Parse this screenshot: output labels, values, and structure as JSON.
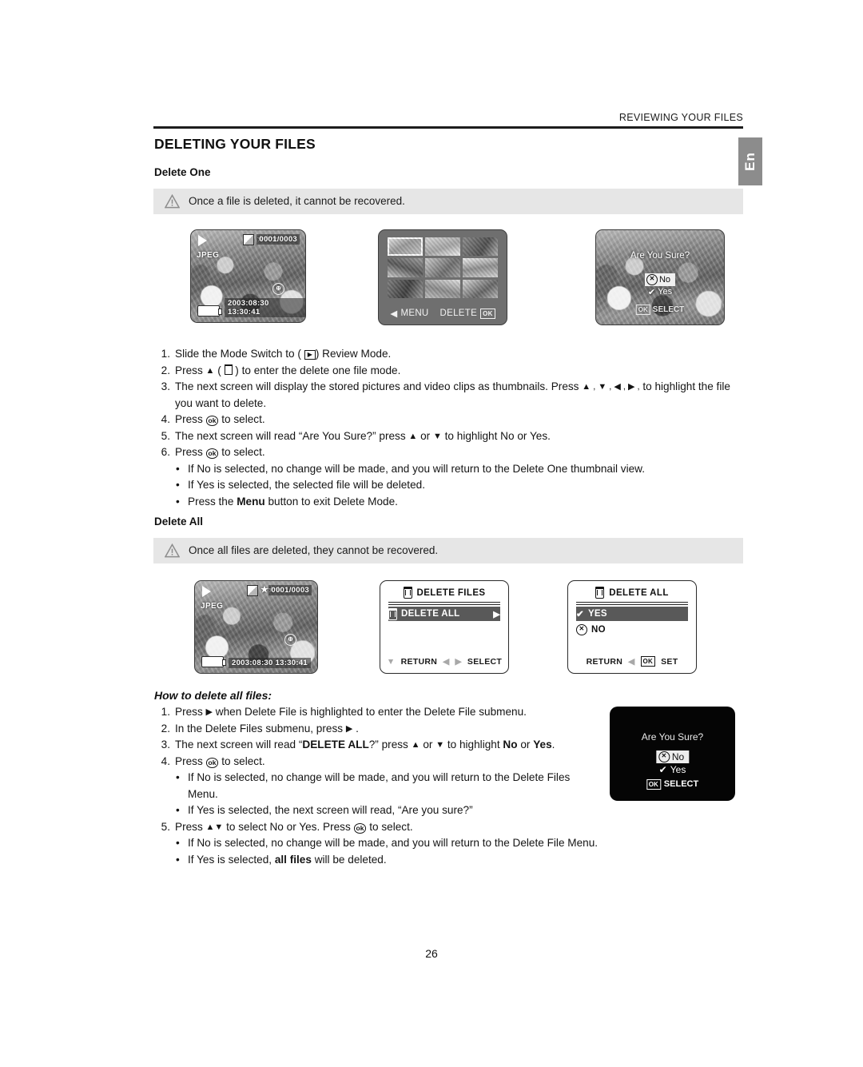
{
  "page": {
    "running_head": "REVIEWING YOUR FILES",
    "language_tab": "En",
    "page_number": "26",
    "title": "DELETING YOUR FILES"
  },
  "delete_one": {
    "heading": "Delete One",
    "warning": "Once a file is deleted, it cannot be recovered.",
    "warning_icon": "warning-triangle-icon",
    "steps": [
      {
        "num": "1.",
        "text_before": "Slide the Mode Switch to (",
        "glyph": "play-icon",
        "text_after": ") Review Mode."
      },
      {
        "num": "2.",
        "text_before": "Press",
        "glyph1": "up-arrow-icon",
        "mid": "(",
        "glyph2": "trash-icon",
        "mid2": ")",
        "text_after": "to enter the delete one file mode."
      },
      {
        "num": "3.",
        "text": "The next screen will display the stored pictures and video clips as thumbnails. Press",
        "arrows": "▲ , ▼ , ◀ , ▶ ,",
        "text2": "to highlight the file you want to delete."
      },
      {
        "num": "4.",
        "text_before": "Press",
        "glyph": "ok-button-icon",
        "text_after": "to select."
      },
      {
        "num": "5.",
        "text_before": "The next screen will read “Are You Sure?” press",
        "glyph1": "up-arrow-icon",
        "mid": "or",
        "glyph2": "down-arrow-icon",
        "text_after": "to highlight No or Yes."
      },
      {
        "num": "6.",
        "text_before": "Press",
        "glyph": "ok-button-icon",
        "text_after": "to select."
      }
    ],
    "bullets": [
      "If No is selected, no change will be made, and you will return to the Delete One thumbnail view.",
      "If Yes is selected, the selected file will be deleted.",
      "Press the Menu button to exit Delete Mode."
    ],
    "bullet3_bold": "Menu"
  },
  "delete_all": {
    "heading": "Delete All",
    "warning": "Once all files are deleted, they cannot be recovered.",
    "howto_heading": "How to delete all files:",
    "steps": [
      {
        "num": "1.",
        "text_before": "Press",
        "glyph": "right-arrow-icon",
        "text_after": "when Delete File is highlighted to enter the Delete File submenu."
      },
      {
        "num": "2.",
        "text_before": "In the Delete Files submenu, press",
        "glyph": "right-arrow-icon",
        "text_after": "."
      },
      {
        "num": "3.",
        "text_before": "The next screen will read “",
        "bold1": "DELETE ALL",
        "mid_a": "?” press",
        "glyph1": "up-arrow-icon",
        "mid_b": "or",
        "glyph2": "down-arrow-icon",
        "mid_c": "to highlight",
        "bold2": "No",
        "mid_d": "or",
        "bold3": "Yes",
        "mid_e": "."
      },
      {
        "num": "4.",
        "text_before": "Press",
        "glyph": "ok-button-icon",
        "text_after": "to select."
      },
      {
        "num": "5.",
        "text_before": "Press",
        "glyph1": "up-arrow-icon",
        "glyph2": "down-arrow-icon",
        "mid": "to select No or Yes. Press",
        "glyph3": "ok-button-icon",
        "text_after": "to select."
      }
    ],
    "bullets_4": [
      "If No is selected, no change will be made, and you will return to the Delete Files Menu.",
      "If Yes is selected, the next screen will read, “Are you sure?”"
    ],
    "bullets_5": [
      "If No is selected, no change will be made, and you will return to the Delete File Menu.",
      "If Yes is selected, all files will be deleted."
    ],
    "bullet5_bold": "all files"
  },
  "screens": {
    "photo_lcd": {
      "play_icon": "play-icon",
      "format": "JPEG",
      "resolution_icon": "resolution-icon",
      "quality_stars": "★★★",
      "counter": "0001/0003",
      "battery_icon": "battery-icon",
      "date": "2003:08:30",
      "time": "13:30:41",
      "zoom_icon": "zoom-icon"
    },
    "thumbnail_grid": {
      "menu_label": "MENU",
      "delete_label": "DELETE",
      "ok_label": "OK",
      "left_arrow": "◀",
      "selected_index": 0,
      "thumb_count": 9
    },
    "are_you_sure_overlay": {
      "title": "Are You Sure?",
      "no_label": "No",
      "yes_label": "Yes",
      "select_label": "SELECT",
      "ok_label": "OK",
      "x_icon": "x-circle-icon",
      "check_icon": "check-icon"
    },
    "delete_files_menu": {
      "title": "DELETE FILES",
      "title_icon": "trash-icon",
      "row_label": "DELETE ALL",
      "row_icon": "trash-icon",
      "row_arrow": "▶",
      "footer_return": "RETURN",
      "footer_select": "SELECT",
      "footer_down": "▼",
      "footer_left": "◀",
      "footer_right": "▶"
    },
    "delete_all_menu": {
      "title": "DELETE ALL",
      "title_icon": "trash-icon",
      "yes_label": "YES",
      "no_label": "NO",
      "footer_return": "RETURN",
      "footer_set": "SET",
      "footer_left": "◀",
      "footer_ok": "OK"
    },
    "black_dialog": {
      "title": "Are You Sure?",
      "no_label": "No",
      "yes_label": "Yes",
      "select_label": "SELECT",
      "ok_label": "OK"
    }
  },
  "colors": {
    "warning_bar_bg": "#e6e6e6",
    "lang_tab_bg": "#8c8c8c",
    "rule": "#1d1d1d",
    "menu_highlight": "#595959",
    "black_dialog_bg": "#050505"
  }
}
